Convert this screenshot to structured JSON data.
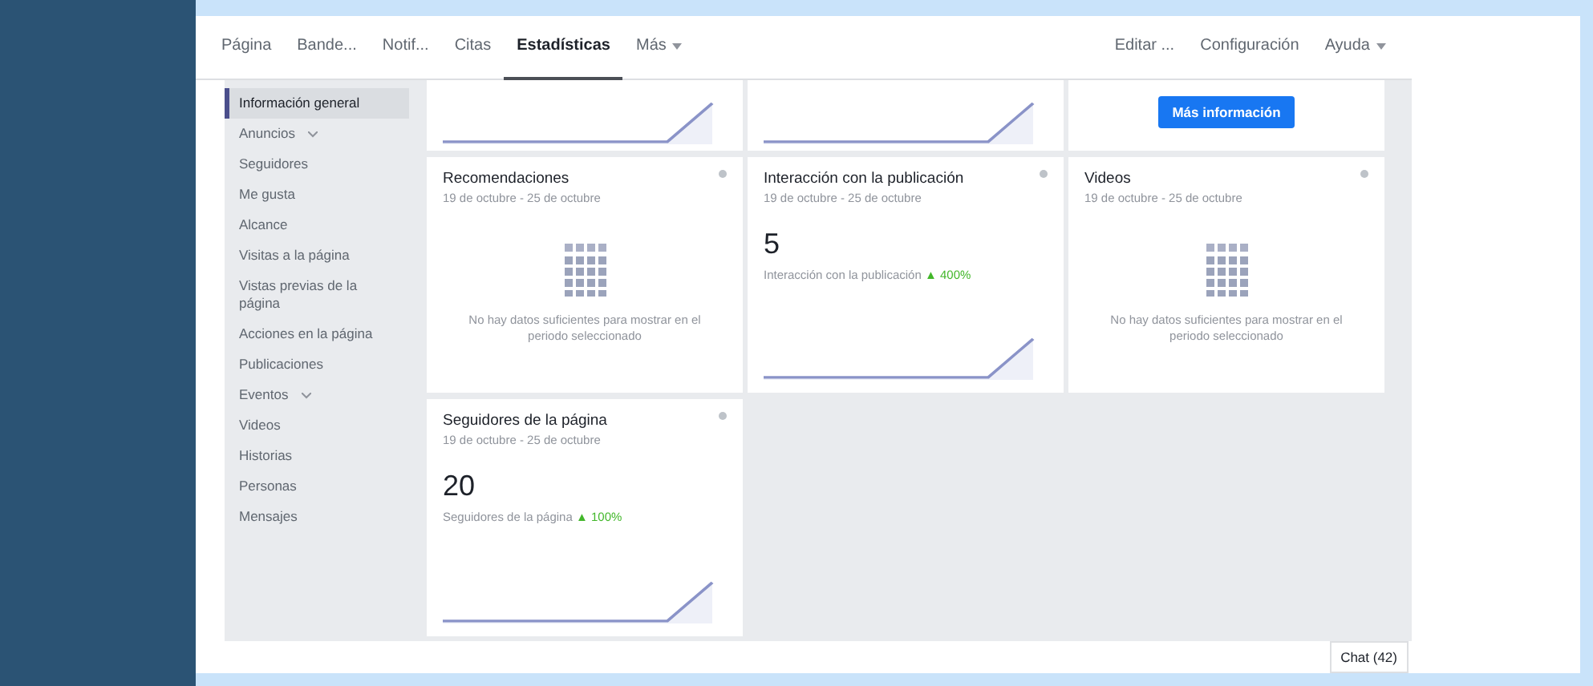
{
  "nav": {
    "left": [
      {
        "label": "Página",
        "selected": false,
        "dropdown": false
      },
      {
        "label": "Bande...",
        "selected": false,
        "dropdown": false
      },
      {
        "label": "Notif...",
        "selected": false,
        "dropdown": false
      },
      {
        "label": "Citas",
        "selected": false,
        "dropdown": false
      },
      {
        "label": "Estadísticas",
        "selected": true,
        "dropdown": false
      },
      {
        "label": "Más",
        "selected": false,
        "dropdown": true
      }
    ],
    "right": [
      {
        "label": "Editar ...",
        "dropdown": false
      },
      {
        "label": "Configuración",
        "dropdown": false
      },
      {
        "label": "Ayuda",
        "dropdown": true
      }
    ]
  },
  "sidebar": {
    "items": [
      {
        "label": "Información general",
        "selected": true,
        "expandable": false
      },
      {
        "label": "Anuncios",
        "selected": false,
        "expandable": true
      },
      {
        "label": "Seguidores",
        "selected": false,
        "expandable": false
      },
      {
        "label": "Me gusta",
        "selected": false,
        "expandable": false
      },
      {
        "label": "Alcance",
        "selected": false,
        "expandable": false
      },
      {
        "label": "Visitas a la página",
        "selected": false,
        "expandable": false
      },
      {
        "label": "Vistas previas de la página",
        "selected": false,
        "expandable": false
      },
      {
        "label": "Acciones en la página",
        "selected": false,
        "expandable": false
      },
      {
        "label": "Publicaciones",
        "selected": false,
        "expandable": false
      },
      {
        "label": "Eventos",
        "selected": false,
        "expandable": true
      },
      {
        "label": "Videos",
        "selected": false,
        "expandable": false
      },
      {
        "label": "Historias",
        "selected": false,
        "expandable": false
      },
      {
        "label": "Personas",
        "selected": false,
        "expandable": false
      },
      {
        "label": "Mensajes",
        "selected": false,
        "expandable": false
      }
    ]
  },
  "top_cards": [
    {
      "kind": "sparkline"
    },
    {
      "kind": "sparkline"
    },
    {
      "kind": "button",
      "button": "Más información"
    }
  ],
  "cards": [
    {
      "kind": "empty",
      "title": "Recomendaciones",
      "dates": "19 de octubre - 25 de octubre",
      "message": "No hay datos suficientes para mostrar en el periodo seleccionado"
    },
    {
      "kind": "metric",
      "title": "Interacción con la publicación",
      "dates": "19 de octubre - 25 de octubre",
      "value": "5",
      "caption": "Interacción con la publicación",
      "change": "▲ 400%"
    },
    {
      "kind": "empty",
      "title": "Videos",
      "dates": "19 de octubre - 25 de octubre",
      "message": "No hay datos suficientes para mostrar en el periodo seleccionado"
    },
    {
      "kind": "metric",
      "title": "Seguidores de la página",
      "dates": "19 de octubre - 25 de octubre",
      "value": "20",
      "caption": "Seguidores de la página",
      "change": "▲ 100%"
    }
  ],
  "chat": {
    "label": "Chat (42)"
  }
}
